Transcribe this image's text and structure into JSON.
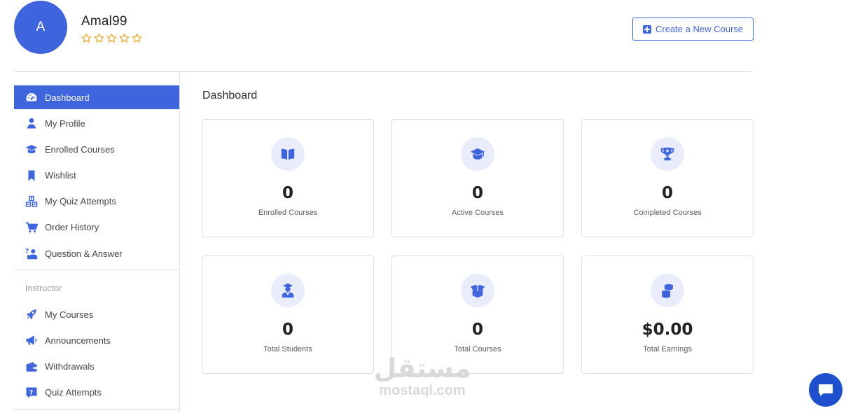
{
  "header": {
    "avatar_initial": "A",
    "username": "Amal99",
    "rating_stars": 5,
    "create_button_label": "Create a New Course"
  },
  "sidebar": {
    "items": [
      {
        "label": "Dashboard",
        "icon": "dashboard-icon",
        "active": true
      },
      {
        "label": "My Profile",
        "icon": "user-icon"
      },
      {
        "label": "Enrolled Courses",
        "icon": "graduation-cap-icon"
      },
      {
        "label": "Wishlist",
        "icon": "bookmark-icon"
      },
      {
        "label": "My Quiz Attempts",
        "icon": "quiz-blocks-icon"
      },
      {
        "label": "Order History",
        "icon": "cart-icon"
      },
      {
        "label": "Question & Answer",
        "icon": "question-person-icon"
      }
    ],
    "instructor_label": "Instructor",
    "instructor_items": [
      {
        "label": "My Courses",
        "icon": "rocket-icon"
      },
      {
        "label": "Announcements",
        "icon": "megaphone-icon"
      },
      {
        "label": "Withdrawals",
        "icon": "wallet-icon"
      },
      {
        "label": "Quiz Attempts",
        "icon": "question-box-icon"
      }
    ]
  },
  "main": {
    "title": "Dashboard",
    "cards": [
      {
        "value": "0",
        "label": "Enrolled Courses",
        "icon": "open-book-icon"
      },
      {
        "value": "0",
        "label": "Active Courses",
        "icon": "graduation-cap-icon"
      },
      {
        "value": "0",
        "label": "Completed Courses",
        "icon": "trophy-icon"
      },
      {
        "value": "0",
        "label": "Total Students",
        "icon": "student-icon"
      },
      {
        "value": "0",
        "label": "Total Courses",
        "icon": "open-box-icon"
      },
      {
        "value": "$0.00",
        "label": "Total Earnings",
        "icon": "coins-icon"
      }
    ]
  },
  "watermark": {
    "arabic": "مستقل",
    "latin": "mostaql.com"
  },
  "colors": {
    "accent": "#3e64de",
    "icon_bg": "#e9edfb",
    "chat": "#1e4fcf",
    "star": "#e8a317"
  }
}
